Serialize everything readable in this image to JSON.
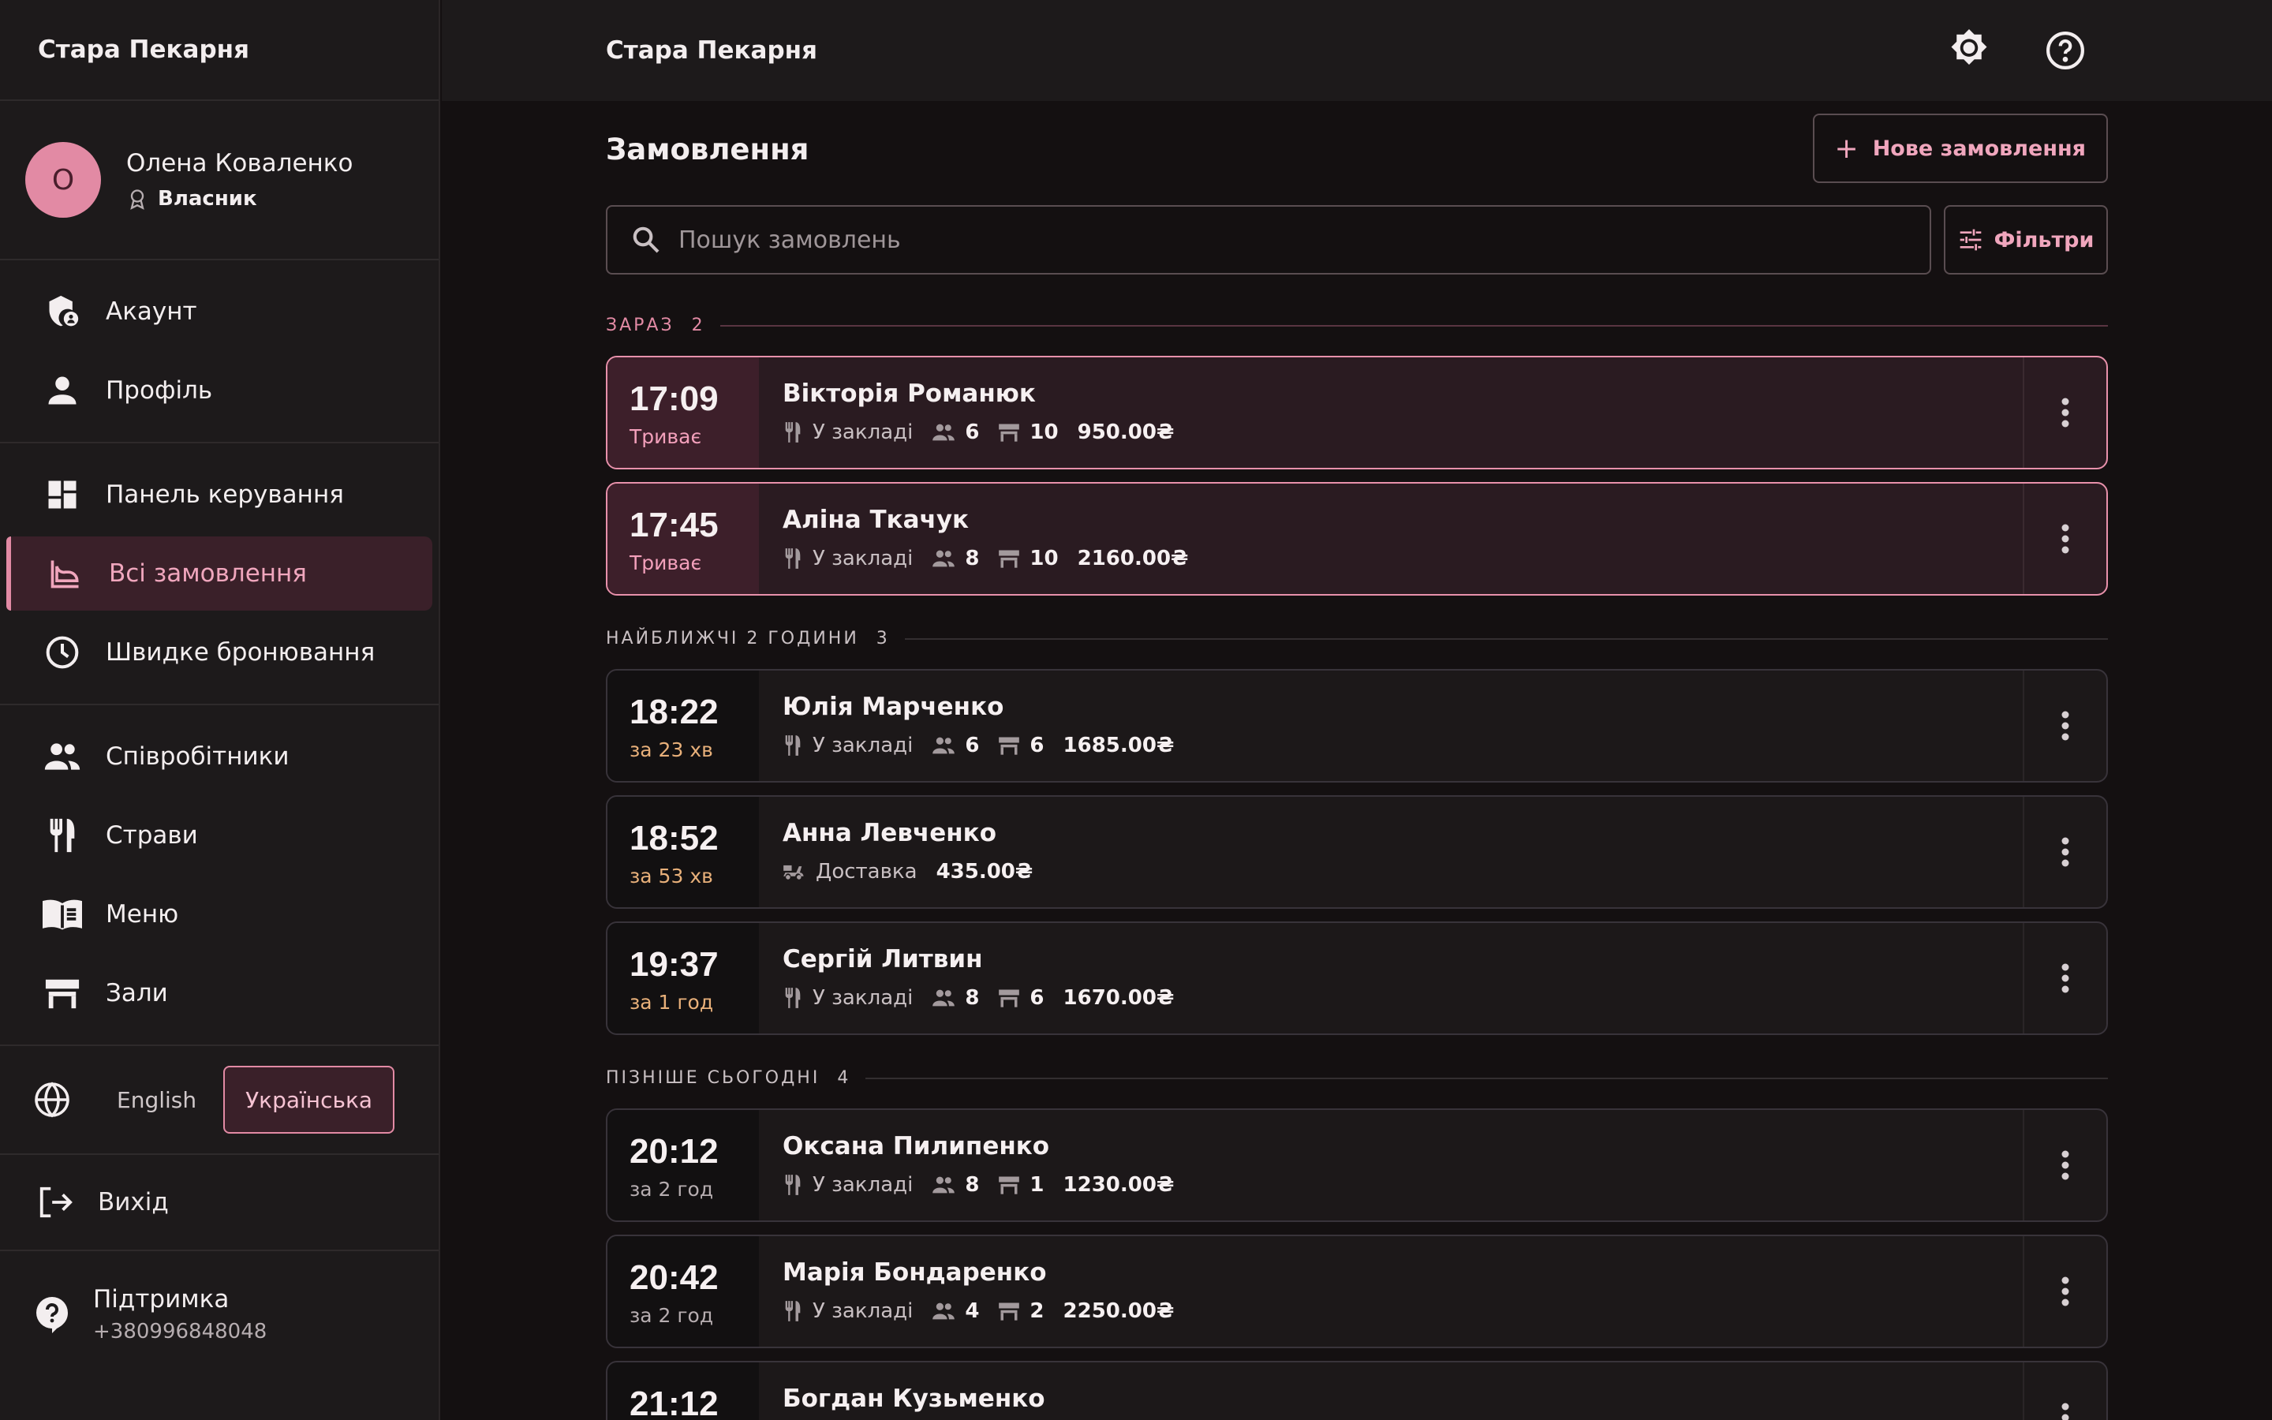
{
  "brand": "Стара Пекарня",
  "user": {
    "initial": "О",
    "name": "Олена Коваленко",
    "role": "Власник"
  },
  "nav": {
    "account": "Акаунт",
    "profile": "Профіль",
    "dashboard": "Панель керування",
    "all_orders": "Всі замовлення",
    "quick_booking": "Швидке бронювання",
    "staff": "Співробітники",
    "dishes": "Страви",
    "menu": "Меню",
    "halls": "Зали"
  },
  "lang": {
    "en": "English",
    "uk": "Українська",
    "selected": "uk"
  },
  "logout": "Вихід",
  "support": {
    "title": "Підтримка",
    "phone": "+380996848048"
  },
  "topbar": {
    "title": "Стара Пекарня"
  },
  "page": {
    "title": "Замовлення",
    "new_order": "Нове замовлення",
    "filters": "Фільтри",
    "search_placeholder": "Пошук замовлень"
  },
  "sections": {
    "now": {
      "label": "ЗАРАЗ",
      "count": "2"
    },
    "next": {
      "label": "НАЙБЛИЖЧІ 2 ГОДИНИ",
      "count": "3"
    },
    "later": {
      "label": "ПІЗНІШЕ СЬОГОДНІ",
      "count": "4"
    }
  },
  "orders": [
    {
      "time": "17:09",
      "status": "Триває",
      "name": "Вікторія Романюк",
      "type": "У закладі",
      "guests": "6",
      "table": "10",
      "total": "950.00₴"
    },
    {
      "time": "17:45",
      "status": "Триває",
      "name": "Аліна Ткачук",
      "type": "У закладі",
      "guests": "8",
      "table": "10",
      "total": "2160.00₴"
    },
    {
      "time": "18:22",
      "status": "за 23 хв",
      "name": "Юлія Марченко",
      "type": "У закладі",
      "guests": "6",
      "table": "6",
      "total": "1685.00₴"
    },
    {
      "time": "18:52",
      "status": "за 53 хв",
      "name": "Анна Левченко",
      "type": "Доставка",
      "total": "435.00₴"
    },
    {
      "time": "19:37",
      "status": "за 1 год",
      "name": "Сергій Литвин",
      "type": "У закладі",
      "guests": "8",
      "table": "6",
      "total": "1670.00₴"
    },
    {
      "time": "20:12",
      "status": "за 2 год",
      "name": "Оксана Пилипенко",
      "type": "У закладі",
      "guests": "8",
      "table": "1",
      "total": "1230.00₴"
    },
    {
      "time": "20:42",
      "status": "за 2 год",
      "name": "Марія Бондаренко",
      "type": "У закладі",
      "guests": "4",
      "table": "2",
      "total": "2250.00₴"
    },
    {
      "time": "21:12",
      "name": "Богдан Кузьменко"
    }
  ],
  "colors": {
    "accent": "#e28aa4",
    "background": "#141011",
    "sidebar": "#1d1a1b",
    "soon": "#e8b07a"
  }
}
